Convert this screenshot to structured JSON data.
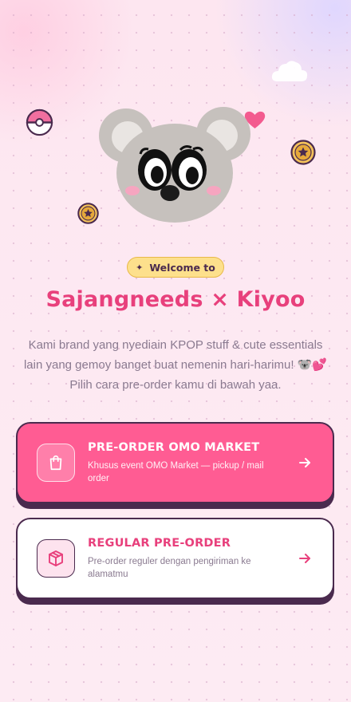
{
  "welcome": {
    "icon": "sparkle-icon",
    "label": "Welcome to"
  },
  "brand": {
    "title": "Sajangneeds × Kiyoo"
  },
  "description": {
    "line1": "Kami brand yang nyediain KPOP stuff & cute essentials",
    "line2": "lain yang gemoy banget buat nemenin hari-harimu! 🐨💕",
    "line3": "Pilih cara pre-order kamu di bawah yaa."
  },
  "options": [
    {
      "icon": "shopping-bag-icon",
      "title": "PRE-ORDER OMO MARKET",
      "subtitle": "Khusus event OMO Market — pickup / mail order",
      "color": "#ff5c93"
    },
    {
      "icon": "package-box-icon",
      "title": "REGULAR PRE-ORDER",
      "subtitle": "Pre-order reguler dengan pengiriman ke alamatmu",
      "color": "#ffffff"
    }
  ],
  "colors": {
    "accent": "#e8407c",
    "outline": "#4a2a4e",
    "pill": "#fde08c"
  }
}
